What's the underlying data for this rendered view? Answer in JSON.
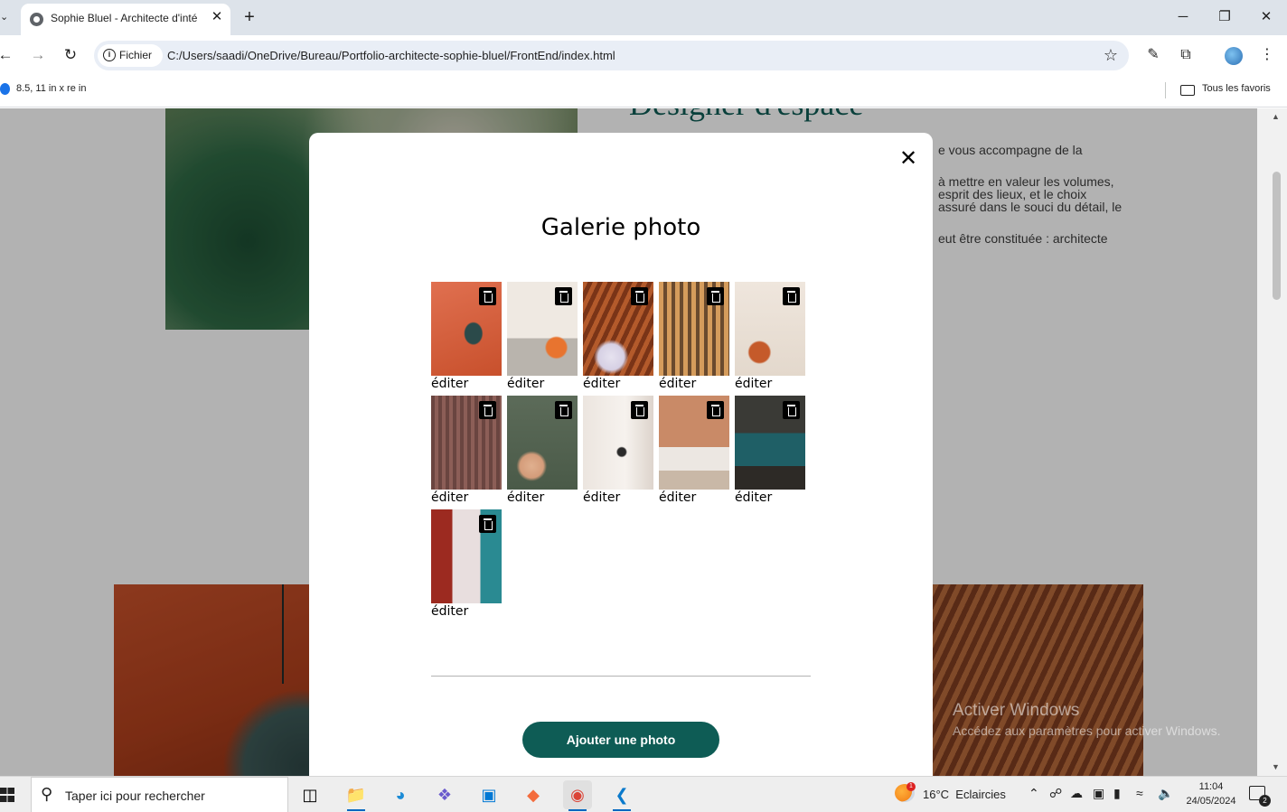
{
  "browser": {
    "tab_title": "Sophie Bluel - Architecte d'inté",
    "tab_close": "✕",
    "new_tab": "+",
    "window_min": "─",
    "window_restore": "❐",
    "window_close": "✕",
    "chip_label": "Fichier",
    "url": "C:/Users/saadi/OneDrive/Bureau/Portfolio-architecte-sophie-bluel/FrontEnd/index.html",
    "bookmark_item": "8.5, 11 in x re in",
    "bookmarks_all": "Tous les favoris"
  },
  "page": {
    "heading": "Designer d'espace",
    "paragraph_lines": [
      "e vous accompagne de la",
      "à mettre en valeur les volumes,",
      "esprit des lieux, et le choix",
      "assuré dans le souci du détail, le",
      "eut être constituée : architecte"
    ]
  },
  "modal": {
    "close_label": "✕",
    "title": "Galerie photo",
    "edit_label": "éditer",
    "add_button": "Ajouter une photo",
    "gallery_count": 11
  },
  "watermark": {
    "line1": "Activer Windows",
    "line2": "Accédez aux paramètres pour activer Windows."
  },
  "taskbar": {
    "search_placeholder": "Taper ici pour rechercher",
    "weather_temp": "16°C",
    "weather_desc": "Eclaircies",
    "weather_badge": "1",
    "time": "11:04",
    "date": "24/05/2024",
    "notif_count": "2"
  },
  "colors": {
    "brand": "#0e5c55",
    "overlay": "rgba(0,0,0,0.30)"
  }
}
